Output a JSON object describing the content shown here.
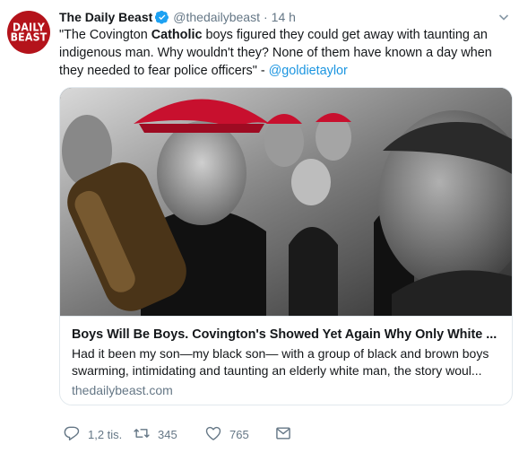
{
  "avatar": {
    "line1": "DAILY",
    "line2": "BEAST"
  },
  "tweet": {
    "name": "The Daily Beast",
    "handle": "@thedailybeast",
    "separator": "·",
    "time": "14 h",
    "text_part1": "\"The Covington ",
    "text_bold": "Catholic",
    "text_part2": " boys figured they could get away with taunting an indigenous man. Why wouldn't they? None of them have known a day when they needed to fear police officers\" - ",
    "mention": "@goldietaylor"
  },
  "card": {
    "image_icon": "photo",
    "title": "Boys Will Be Boys. Covington's Showed Yet Again Why Only White ...",
    "description_line1": "Had it been my son—my black son— with a group of black and brown boys",
    "description_line2": "swarming, intimidating and taunting an elderly white man, the story woul...",
    "domain": "thedailybeast.com"
  },
  "actions": {
    "reply_count": "1,2 tis.",
    "retweet_count": "345",
    "like_count": "765"
  },
  "icons": {
    "verified": "verified-badge-icon",
    "caret": "chevron-down-icon",
    "reply": "reply-icon",
    "retweet": "retweet-icon",
    "like": "heart-icon",
    "dm": "envelope-icon"
  },
  "colors": {
    "brand_red": "#b4131b",
    "link_blue": "#1b95e0",
    "secondary_text": "#657786",
    "cap_red": "#c8102e"
  }
}
